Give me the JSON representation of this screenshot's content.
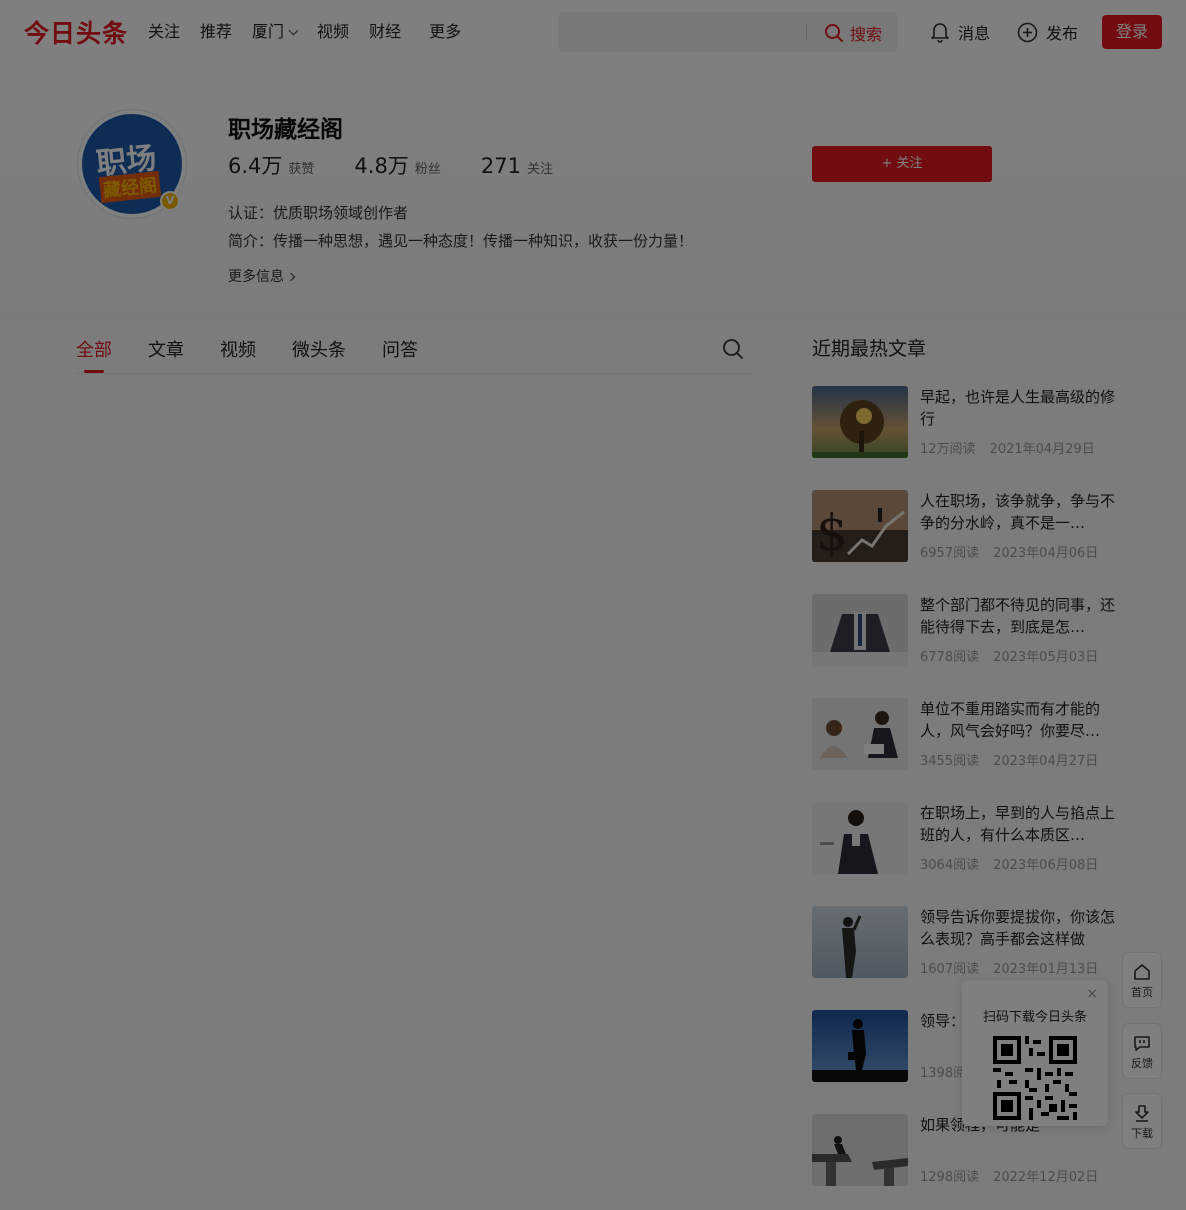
{
  "header": {
    "logo": "今日头条",
    "nav": [
      "关注",
      "推荐",
      "厦门",
      "视频",
      "财经",
      "更多"
    ],
    "search": {
      "placeholder": "",
      "button_label": "搜索"
    },
    "messages_label": "消息",
    "publish_label": "发布",
    "login_label": "登录"
  },
  "profile": {
    "name": "职场藏经阁",
    "avatar_text_top": "职场",
    "avatar_text_bottom": "藏经阁",
    "verified_badge": "V",
    "stats": [
      {
        "value": "6.4万",
        "label": "获赞"
      },
      {
        "value": "4.8万",
        "label": "粉丝"
      },
      {
        "value": "271",
        "label": "关注"
      }
    ],
    "follow_button": "+ 关注",
    "certification": "认证：优质职场领域创作者",
    "intro": "简介：传播一种思想，遇见一种态度！传播一种知识，收获一份力量！",
    "more_info": "更多信息"
  },
  "tabs": [
    "全部",
    "文章",
    "视频",
    "微头条",
    "问答"
  ],
  "active_tab": "全部",
  "hot_articles": {
    "title": "近期最热文章",
    "items": [
      {
        "title": "早起，也许是人生最高级的修行",
        "reads": "12万阅读",
        "date": "2021年04月29日"
      },
      {
        "title": "人在职场，该争就争，争与不争的分水岭，真不是一…",
        "reads": "6957阅读",
        "date": "2023年04月06日"
      },
      {
        "title": "整个部门都不待见的同事，还能待得下去，到底是怎…",
        "reads": "6778阅读",
        "date": "2023年05月03日"
      },
      {
        "title": "单位不重用踏实而有才能的人，风气会好吗？你要尽…",
        "reads": "3455阅读",
        "date": "2023年04月27日"
      },
      {
        "title": "在职场上，早到的人与掐点上班的人，有什么本质区…",
        "reads": "3064阅读",
        "date": "2023年06月08日"
      },
      {
        "title": "领导告诉你要提拔你，你该怎么表现？高手都会这样做",
        "reads": "1607阅读",
        "date": "2023年01月13日"
      },
      {
        "title": "领导：人“能",
        "reads": "1398阅",
        "date": ""
      },
      {
        "title": "如果领程，可能是",
        "reads": "1298阅读",
        "date": "2022年12月02日"
      }
    ]
  },
  "side": {
    "home_label": "首页",
    "feedback_label": "反馈",
    "download_label": "下载",
    "qr_text": "扫码下载今日头条",
    "qr_close": "×"
  },
  "colors": {
    "brand": "#e31b23",
    "overlay": "rgba(0,0,0,0.5)"
  }
}
